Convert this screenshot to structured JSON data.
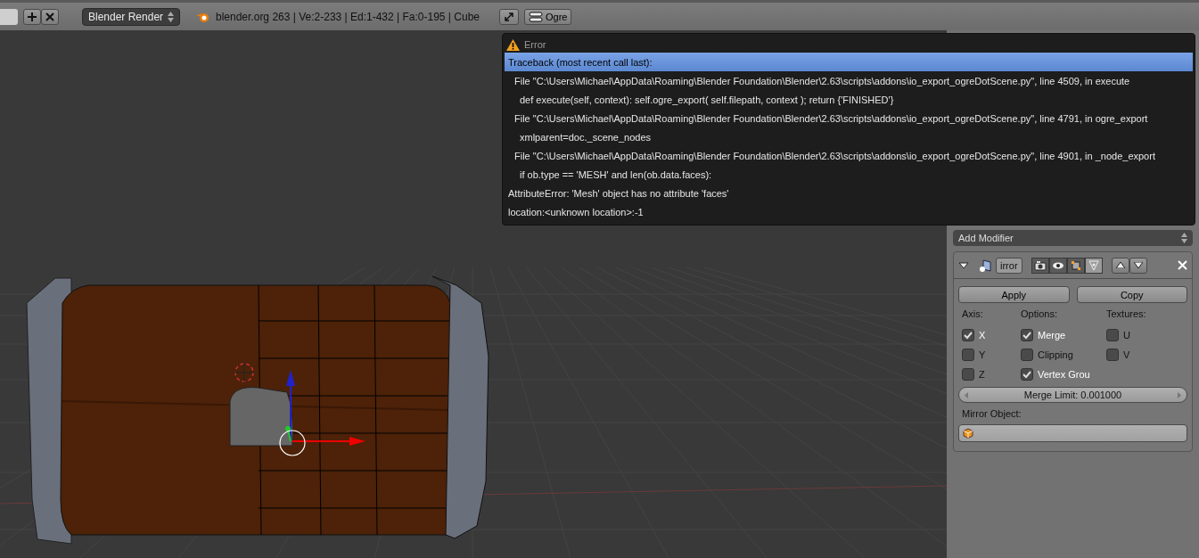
{
  "header": {
    "render_engine": "Blender Render",
    "stats": "blender.org 263 | Ve:2-233 | Ed:1-432 | Fa:0-195 | Cube",
    "addon_button": "Ogre"
  },
  "error_popup": {
    "title": "Error",
    "lines": [
      {
        "kind": "heading",
        "text": "Traceback (most recent call last):",
        "selected": true
      },
      {
        "kind": "file",
        "text": "File \"C:\\Users\\Michael\\AppData\\Roaming\\Blender Foundation\\Blender\\2.63\\scripts\\addons\\io_export_ogreDotScene.py\", line 4509, in execute",
        "selected": false
      },
      {
        "kind": "code",
        "text": "def execute(self, context): self.ogre_export(  self.filepath, context ); return {'FINISHED'}",
        "selected": false
      },
      {
        "kind": "file",
        "text": "File \"C:\\Users\\Michael\\AppData\\Roaming\\Blender Foundation\\Blender\\2.63\\scripts\\addons\\io_export_ogreDotScene.py\", line 4791, in ogre_export",
        "selected": false
      },
      {
        "kind": "code",
        "text": "xmlparent=doc._scene_nodes",
        "selected": false
      },
      {
        "kind": "file",
        "text": "File \"C:\\Users\\Michael\\AppData\\Roaming\\Blender Foundation\\Blender\\2.63\\scripts\\addons\\io_export_ogreDotScene.py\", line 4901, in _node_export",
        "selected": false
      },
      {
        "kind": "code",
        "text": "if ob.type == 'MESH' and len(ob.data.faces):",
        "selected": false
      },
      {
        "kind": "heading",
        "text": "AttributeError: 'Mesh' object has no attribute 'faces'",
        "selected": false
      },
      {
        "kind": "heading",
        "text": "location:<unknown location>:-1",
        "selected": false
      }
    ]
  },
  "properties": {
    "add_modifier": "Add Modifier",
    "modifier": {
      "expanded": true,
      "name": "irror",
      "toggles": [
        {
          "kind": "render",
          "on": true
        },
        {
          "kind": "view",
          "on": true
        },
        {
          "kind": "editmode",
          "on": true
        },
        {
          "kind": "cage",
          "on": false
        }
      ],
      "buttons": [
        "Apply",
        "Copy"
      ],
      "columns": [
        {
          "title": "Axis:",
          "options": [
            {
              "label": "X",
              "checked": true
            },
            {
              "label": "Y",
              "checked": false
            },
            {
              "label": "Z",
              "checked": false
            }
          ]
        },
        {
          "title": "Options:",
          "options": [
            {
              "label": "Merge",
              "checked": true
            },
            {
              "label": "Clipping",
              "checked": false
            },
            {
              "label": "Vertex Grou",
              "checked": true
            }
          ]
        },
        {
          "title": "Textures:",
          "options": [
            {
              "label": "U",
              "checked": false
            },
            {
              "label": "V",
              "checked": false
            }
          ]
        }
      ],
      "merge_limit": "Merge Limit: 0.001000",
      "mirror_object_label": "Mirror Object:"
    }
  }
}
